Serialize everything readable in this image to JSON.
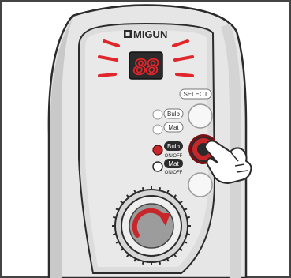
{
  "device": {
    "brand": "MIGUN",
    "display_value": "88",
    "select_label": "SELECT",
    "buttons": [
      {
        "label": "Bulb",
        "sublabel": ""
      },
      {
        "label": "Mat",
        "sublabel": ""
      },
      {
        "label": "Bulb",
        "sublabel": "ON/OFF"
      },
      {
        "label": "Mat",
        "sublabel": "ON/OFF"
      }
    ]
  },
  "colors": {
    "panel": "#e4e4e4",
    "panel_inner": "#cfcfcf",
    "display_bg": "#2a2a2a",
    "digit_red": "#e0262b",
    "accent_red": "#c7262b",
    "dark_label": "#2b2b2b",
    "hand_skin": "#ffffff"
  },
  "icons": {
    "brand_logo": "migun-square-logo",
    "hand": "pointing-hand-icon",
    "dial_arrow": "clockwise-arrow-icon"
  }
}
